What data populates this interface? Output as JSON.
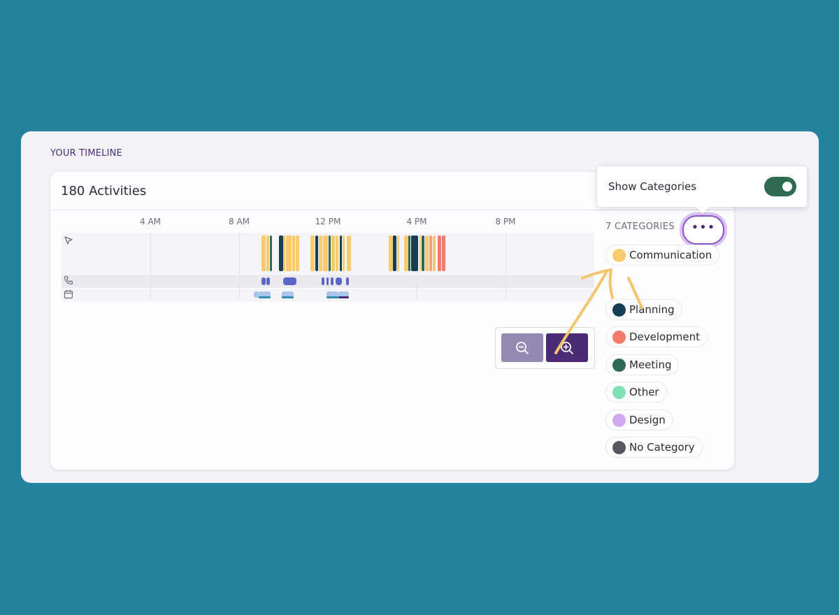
{
  "timeline": {
    "section_title": "YOUR TIMELINE",
    "activities_label": "180 Activities",
    "hours": [
      "4 AM",
      "8 AM",
      "12 PM",
      "4 PM",
      "8 PM"
    ],
    "lanes": [
      {
        "name": "activity",
        "icon": "cursor-icon"
      },
      {
        "name": "calls",
        "icon": "phone-icon"
      },
      {
        "name": "meetings",
        "icon": "calendar-icon"
      }
    ]
  },
  "zoom": {
    "out_icon": "zoom-out-icon",
    "in_icon": "zoom-in-icon"
  },
  "categories": {
    "header": "7 CATEGORIES",
    "more_icon": "more-icon",
    "more_label": "•••",
    "items": [
      {
        "label": "Communication",
        "color": "#f7cb6d"
      },
      {
        "label": "Planning",
        "color": "#173f53"
      },
      {
        "label": "Development",
        "color": "#f47b6a"
      },
      {
        "label": "Meeting",
        "color": "#2f6b52"
      },
      {
        "label": "Other",
        "color": "#7fe0b8"
      },
      {
        "label": "Design",
        "color": "#cfa8ef"
      },
      {
        "label": "No Category",
        "color": "#58565e"
      }
    ]
  },
  "popover": {
    "label": "Show Categories",
    "toggle_on": true
  },
  "colors": {
    "background": "#23829e",
    "brand_purple": "#4b2c74",
    "call": "#5a67c7",
    "meeting_light": "#a8c6ea",
    "meeting_teal": "#2f8ea8"
  }
}
